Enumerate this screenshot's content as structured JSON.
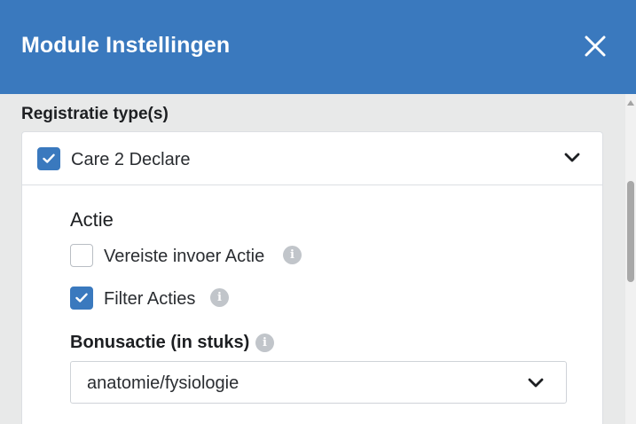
{
  "header": {
    "title": "Module Instellingen"
  },
  "section": {
    "label": "Registratie type(s)"
  },
  "card": {
    "title": "Care 2 Declare",
    "checked": true,
    "group_title": "Actie",
    "options": [
      {
        "label": "Vereiste invoer Actie",
        "checked": false
      },
      {
        "label": "Filter Acties",
        "checked": true
      }
    ],
    "field": {
      "label": "Bonusactie (in stuks)",
      "value": "anatomie/fysiologie"
    }
  },
  "colors": {
    "primary": "#3a79be",
    "background": "#e8e9e9",
    "info": "#c1c5ca"
  },
  "icons": {
    "close": "close-icon",
    "chevron": "chevron-down-icon",
    "info": "info-icon",
    "check": "check-icon"
  }
}
